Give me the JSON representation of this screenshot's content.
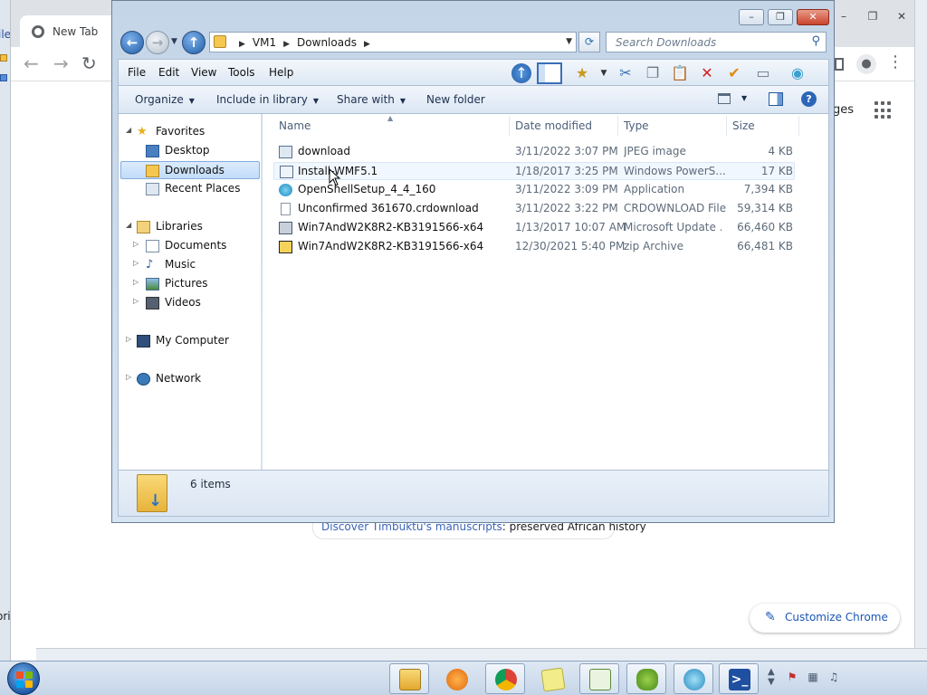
{
  "chrome": {
    "tab_title": "New Tab",
    "nav_back": "←",
    "nav_forward": "→",
    "reload": "↻",
    "images_link": "ges",
    "discover_link": "Discover Timbuktu's manuscripts",
    "discover_rest": ": preserved African history",
    "customize_label": "Customize Chrome",
    "window_min": "–",
    "window_max": "❐",
    "window_close": "✕",
    "kebab": "⋮"
  },
  "left_strip": {
    "top_text": "ile",
    "bottom_text": "ori"
  },
  "explorer": {
    "window_min": "–",
    "window_max": "❐",
    "window_close": "✕",
    "address": {
      "crumbs": [
        "VM1",
        "Downloads"
      ],
      "dropdown": "▼"
    },
    "search_placeholder": "Search Downloads",
    "menu": [
      "File",
      "Edit",
      "View",
      "Tools",
      "Help"
    ],
    "commands": {
      "organize": "Organize",
      "include_in_library": "Include in library",
      "share_with": "Share with",
      "new_folder": "New folder"
    },
    "help_label": "?",
    "nav_pane": {
      "favorites": "Favorites",
      "desktop": "Desktop",
      "downloads": "Downloads",
      "recent_places": "Recent Places",
      "libraries": "Libraries",
      "documents": "Documents",
      "music": "Music",
      "pictures": "Pictures",
      "videos": "Videos",
      "my_computer": "My Computer",
      "network": "Network"
    },
    "columns": {
      "name": "Name",
      "date_modified": "Date modified",
      "type": "Type",
      "size": "Size"
    },
    "files": [
      {
        "name": "download",
        "date": "3/11/2022 3:07 PM",
        "type": "JPEG image",
        "size": "4 KB",
        "icon": "image-file-icon"
      },
      {
        "name": "Install-WMF5.1",
        "date": "1/18/2017 3:25 PM",
        "type": "Windows PowerS...",
        "size": "17 KB",
        "icon": "powershell-script-icon"
      },
      {
        "name": "OpenShellSetup_4_4_160",
        "date": "3/11/2022 3:09 PM",
        "type": "Application",
        "size": "7,394 KB",
        "icon": "openshell-shell-icon"
      },
      {
        "name": "Unconfirmed 361670.crdownload",
        "date": "3/11/2022 3:22 PM",
        "type": "CRDOWNLOAD File",
        "size": "59,314 KB",
        "icon": "blank-file-icon"
      },
      {
        "name": "Win7AndW2K8R2-KB3191566-x64",
        "date": "1/13/2017 10:07 AM",
        "type": "Microsoft Update ...",
        "size": "66,460 KB",
        "icon": "msu-package-icon"
      },
      {
        "name": "Win7AndW2K8R2-KB3191566-x64",
        "date": "12/30/2021 5:40 PM",
        "type": "zip Archive",
        "size": "66,481 KB",
        "icon": "zip-archive-icon"
      }
    ],
    "status": {
      "item_count": "6 items"
    }
  },
  "taskbar": {
    "apps": [
      "file-explorer-icon",
      "media-player-icon",
      "chrome-icon",
      "sticky-notes-icon",
      "notepad-plus-icon",
      "gitbash-frog-icon",
      "openshell-icon",
      "powershell-icon"
    ]
  },
  "colors": {
    "explorer_frame": "#c4d5e8",
    "selection": "#c1dcfa",
    "accent_blue": "#1f5ea8",
    "close_red": "#c9452c"
  }
}
